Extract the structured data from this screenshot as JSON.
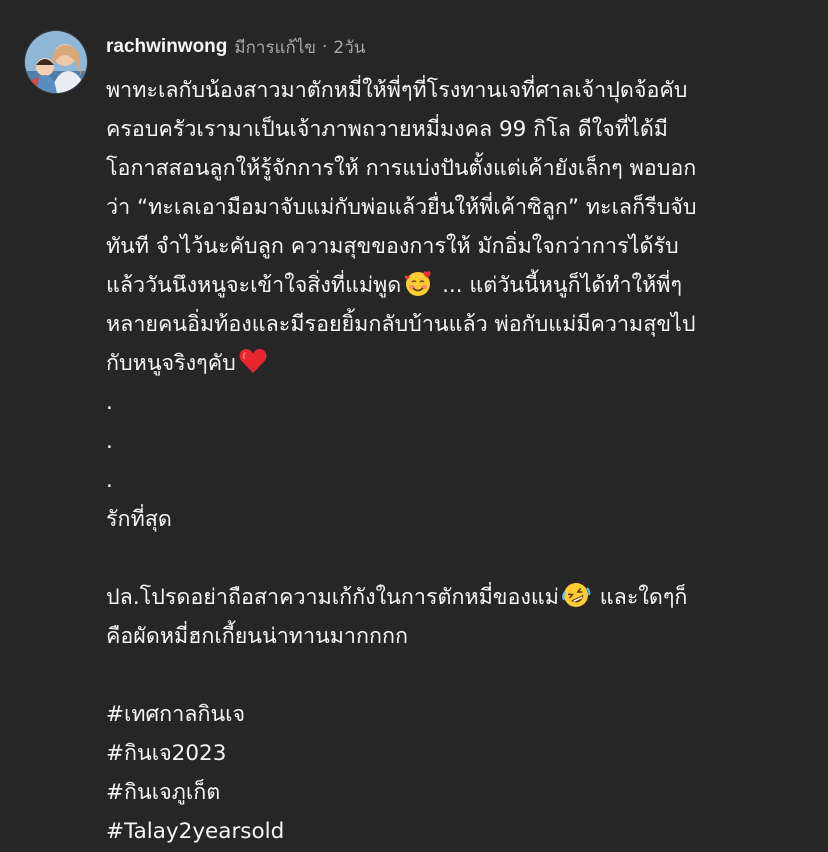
{
  "comment": {
    "username": "rachwinwong",
    "edited_label": "มีการแก้ไข",
    "separator": "·",
    "time": "2วัน",
    "avatar_icon": "profile-photo",
    "caption": {
      "lines": [
        "พาทะเลกับน้องสาวมาตักหมี่ให้พี่ๆที่โรงทานเจที่ศาลเจ้าปุดจ้อคับ",
        "ครอบครัวเรามาเป็นเจ้าภาพถวายหมี่มงคล 99 กิโล ดีใจที่ได้มี",
        "โอกาสสอนลูกให้รู้จักการให้ การแบ่งปันตั้งแต่เค้ายังเล็กๆ พอบอก",
        "ว่า “ทะเลเอามือมาจับแม่กับพ่อแล้วยื่นให้พี่เค้าซิลูก” ทะเลก็รีบจับ",
        "ทันที จำไว้นะคับลูก ความสุขของการให้ มักอิ่มใจกว่าการได้รับ"
      ],
      "line6_a": "แล้ววันนึงหนูจะเข้าใจสิ่งที่แม่พูด",
      "line6_b": " ... แต่วันนี้หนูก็ได้ทำให้พี่ๆ",
      "line7": "หลายคนอิ่มท้องและมีรอยยิ้มกลับบ้านแล้ว พ่อกับแม่มีความสุขไป",
      "line8": "กับหนูจริงๆคับ",
      "dots": [
        ".",
        ".",
        "."
      ],
      "love_line": "รักที่สุด",
      "ps_line1_a": "ปล.โปรดอย่าถือสาความเก้กังในการตักหมี่ของแม่",
      "ps_line1_b": " และใดๆก็",
      "ps_line2": "คือผัดหมี่ฮกเกี้ยนน่าทานมากกกก",
      "hashtags": [
        "#เทศกาลกินเจ",
        "#กินเจ2023",
        "#กินเจภูเก็ต",
        "#Talay2yearsold"
      ],
      "emojis": {
        "smile_hearts": "smiling-face-with-hearts-emoji",
        "heart": "red-heart-emoji",
        "laugh": "rolling-on-floor-laughing-emoji"
      }
    }
  },
  "colors": {
    "background": "#262626",
    "text": "#f5f5f5",
    "meta": "#a8a8a8"
  }
}
